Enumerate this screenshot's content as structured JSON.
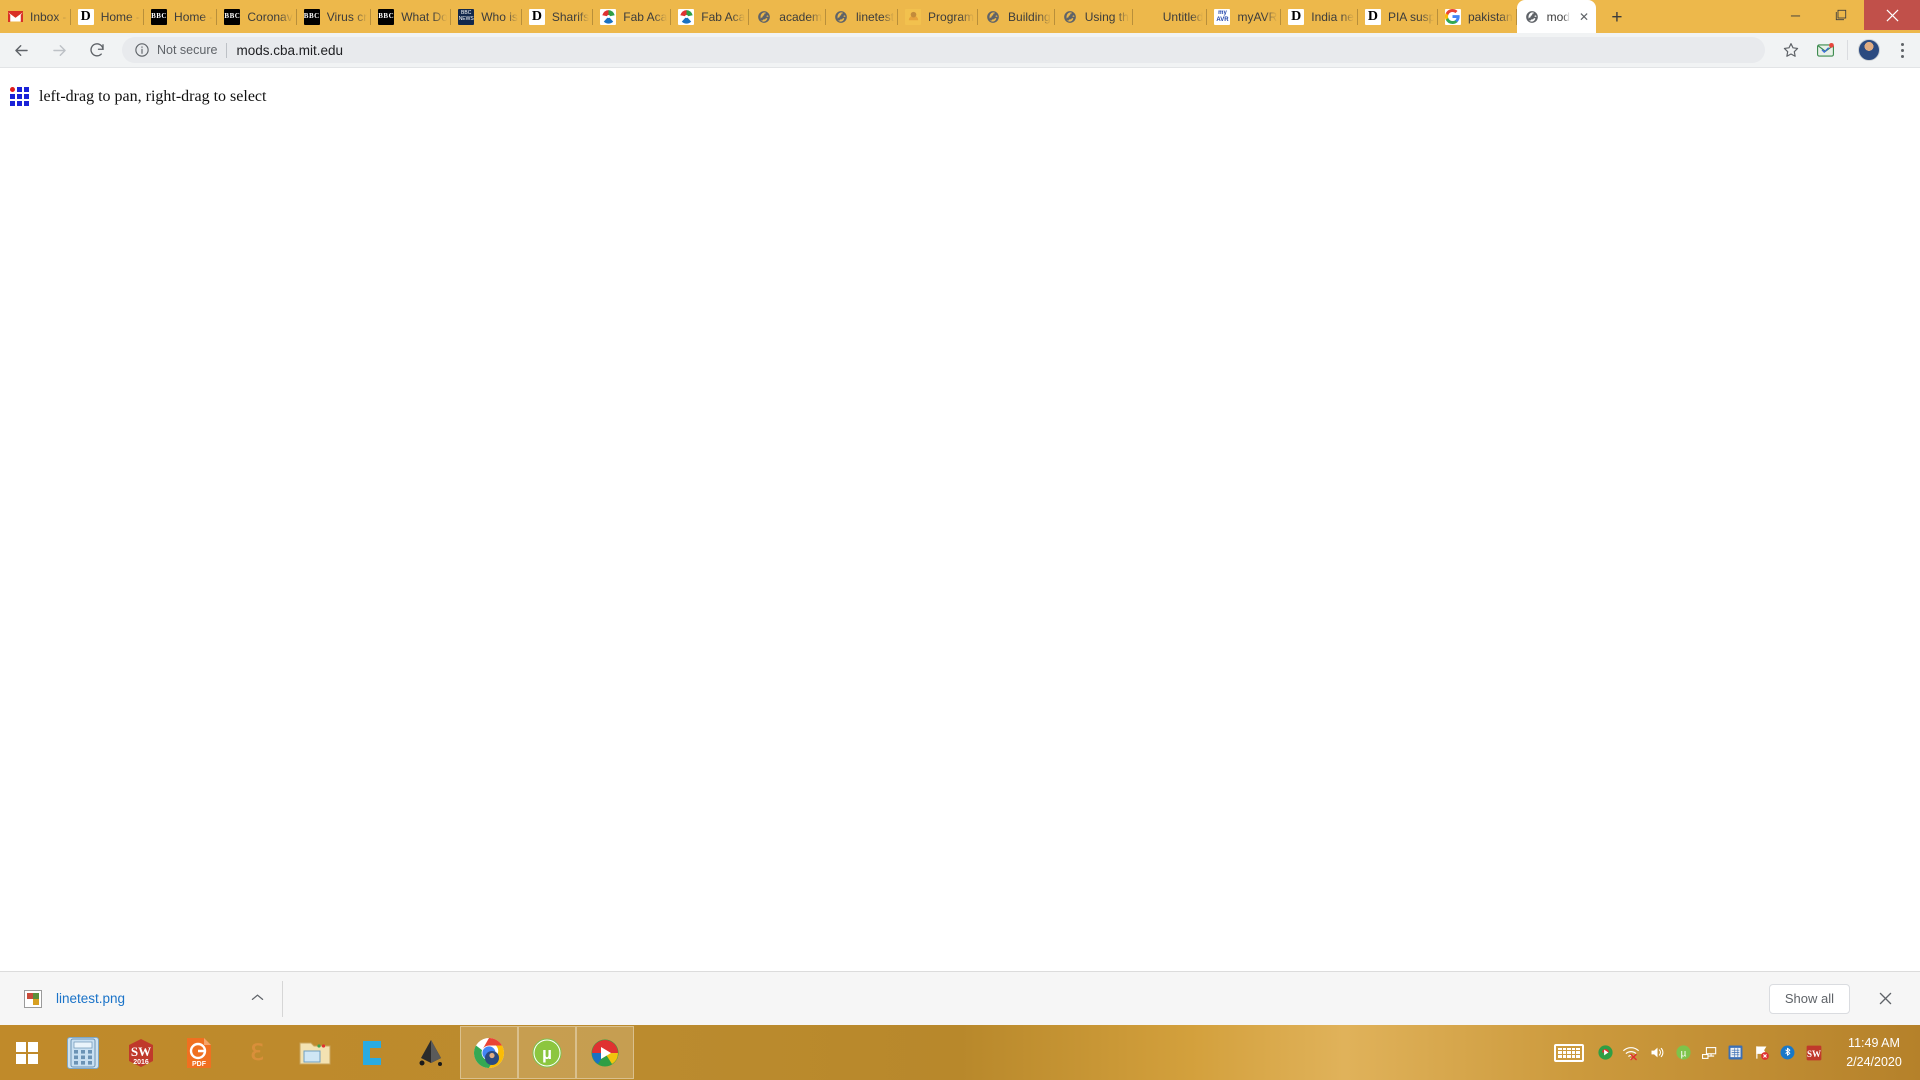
{
  "browser": {
    "tabs": [
      {
        "favicon": "gmail-icon",
        "title": "Inbox -"
      },
      {
        "favicon": "dawn-icon",
        "title": "Home -"
      },
      {
        "favicon": "bbc-icon",
        "title": "Home -"
      },
      {
        "favicon": "bbc-icon",
        "title": "Coronav"
      },
      {
        "favicon": "bbc-icon",
        "title": "Virus cr"
      },
      {
        "favicon": "bbc-icon",
        "title": "What Do"
      },
      {
        "favicon": "bbc-news-icon",
        "title": "Who is"
      },
      {
        "favicon": "dawn-icon",
        "title": "Sharifs"
      },
      {
        "favicon": "fabacademy-icon",
        "title": "Fab Aca"
      },
      {
        "favicon": "fabacademy-icon",
        "title": "Fab Aca"
      },
      {
        "favicon": "globe-icon",
        "title": "academ"
      },
      {
        "favicon": "globe-icon",
        "title": "linetest"
      },
      {
        "favicon": "program-icon",
        "title": "Program"
      },
      {
        "favicon": "globe-icon",
        "title": "Building"
      },
      {
        "favicon": "globe-icon",
        "title": "Using th"
      },
      {
        "favicon": "none",
        "title": "Untitled"
      },
      {
        "favicon": "myavr-icon",
        "title": "myAVR"
      },
      {
        "favicon": "dawn-icon",
        "title": "India ne"
      },
      {
        "favicon": "dawn-icon",
        "title": "PIA susp"
      },
      {
        "favicon": "google-icon",
        "title": "pakistan"
      }
    ],
    "active_tab": {
      "favicon": "globe-icon",
      "title": "mod",
      "close_label": "✕"
    },
    "new_tab_label": "+",
    "window_controls": {
      "minimize": "─",
      "maximize": "❐",
      "close": "✕"
    },
    "toolbar": {
      "back_label": "←",
      "forward_label": "→",
      "reload_label": "⟳",
      "security_icon": "info-circle-icon",
      "security_text": "Not secure",
      "url": "mods.cba.mit.edu",
      "bookmark_label": "☆",
      "extension_icon": "mail-extension-icon",
      "menu_label": "⋮"
    },
    "accent_tabstrip_color": "#edb84b",
    "close_button_color": "#c1504a"
  },
  "page": {
    "grid_icon": "mods-grid-icon",
    "hint": "left-drag to pan, right-drag to select"
  },
  "download_shelf": {
    "file_icon": "image-file-icon",
    "file_name": "linetest.png",
    "caret_label": "⌃",
    "show_all_label": "Show all",
    "close_label": "✕"
  },
  "taskbar": {
    "start_label": "start-button",
    "apps": [
      {
        "icon": "calculator-icon",
        "name": "Calculator",
        "open": false
      },
      {
        "icon": "solidworks-icon",
        "name": "SW 2016",
        "open": false,
        "label": "SW",
        "sub": "2016"
      },
      {
        "icon": "gpdf-icon",
        "name": "PDF Reader",
        "open": false,
        "label": "PDF"
      },
      {
        "icon": "eagle-icon",
        "name": "Eagle",
        "open": false,
        "label": "E"
      },
      {
        "icon": "file-explorer-icon",
        "name": "File Explorer",
        "open": false
      },
      {
        "icon": "cura-icon",
        "name": "Cura",
        "open": false,
        "label": "C"
      },
      {
        "icon": "inkscape-icon",
        "name": "Inkscape",
        "open": false,
        "label": "✒"
      },
      {
        "icon": "chrome-icon",
        "name": "Google Chrome",
        "open": true
      },
      {
        "icon": "utorrent-icon",
        "name": "uTorrent",
        "open": true,
        "label": "μ"
      },
      {
        "icon": "idm-icon",
        "name": "Internet Download Manager",
        "open": true
      }
    ],
    "tray": [
      {
        "icon": "onscreen-keyboard-icon"
      },
      {
        "icon": "idm-tray-icon",
        "glyph": "◉"
      },
      {
        "icon": "wifi-disconnected-icon",
        "glyph": "◠"
      },
      {
        "icon": "volume-icon",
        "glyph": "🔊"
      },
      {
        "icon": "utorrent-tray-icon",
        "glyph": "μ"
      },
      {
        "icon": "network-icon",
        "glyph": "⎒"
      },
      {
        "icon": "excel-tray-icon",
        "glyph": "▦"
      },
      {
        "icon": "flag-error-icon",
        "glyph": "⚑"
      },
      {
        "icon": "bluetooth-icon",
        "glyph": "ᛦ"
      },
      {
        "icon": "solidworks-tray-icon",
        "glyph": "SW"
      }
    ],
    "clock": {
      "time": "11:49 AM",
      "date": "2/24/2020"
    }
  }
}
